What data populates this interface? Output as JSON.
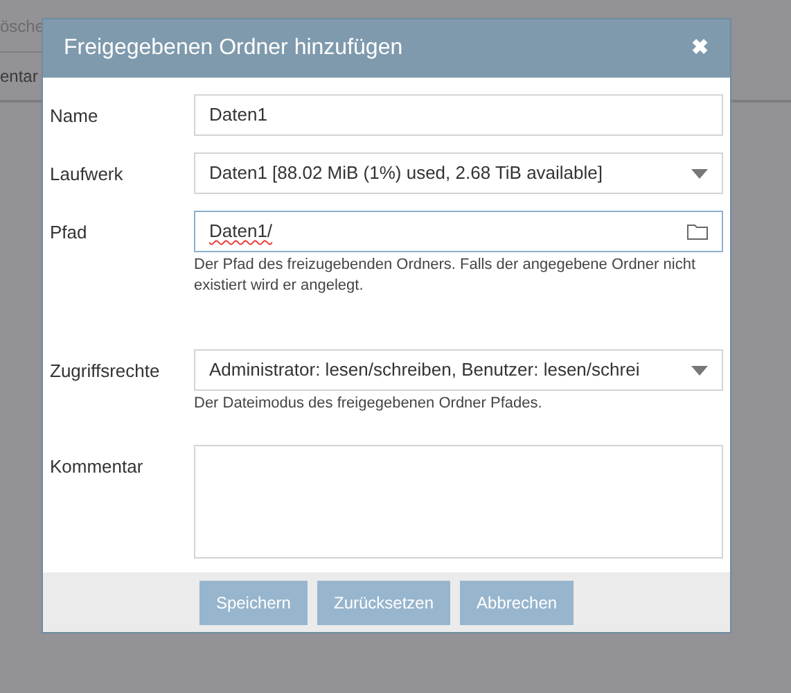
{
  "background": {
    "fragments": [
      "ösche",
      "entar"
    ]
  },
  "dialog": {
    "title": "Freigegebenen Ordner hinzufügen",
    "close": "✖",
    "fields": [
      {
        "kind": "text",
        "label": "Name",
        "value": "Daten1",
        "focused": false
      },
      {
        "kind": "select",
        "label": "Laufwerk",
        "value": "Daten1 [88.02 MiB (1%) used, 2.68 TiB available]",
        "focused": false
      },
      {
        "kind": "folder",
        "label": "Pfad",
        "value": "Daten1/",
        "focused": true,
        "hint": "Der Pfad des freizugebenden Ordners. Falls der angegebene Ordner nicht existiert wird er angelegt."
      },
      {
        "kind": "select",
        "label": "Zugriffsrechte",
        "value": "Administrator: lesen/schreiben, Benutzer: lesen/schrei",
        "focused": false,
        "hint": "Der Dateimodus des freigegebenen Ordner Pfades."
      },
      {
        "kind": "textarea",
        "label": "Kommentar",
        "focused": false
      }
    ],
    "buttons": [
      "Speichern",
      "Zurücksetzen",
      "Abbrechen"
    ]
  }
}
